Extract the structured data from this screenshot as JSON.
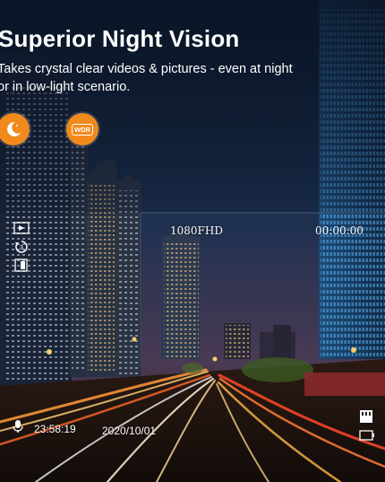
{
  "headline": "Superior Night Vision",
  "subtext": "Takes crystal clear videos & pictures - even at night\nor in low-light scenario.",
  "badges": [
    {
      "icon": "moon-icon",
      "color": "#f08a1c"
    },
    {
      "icon": "wdr-icon",
      "label": "WDR",
      "color": "#f08a1c"
    }
  ],
  "hud": {
    "resolution": "1080FHD",
    "timer": "00:00:00",
    "clock": "23:58:19",
    "date": "2020/10/01",
    "left_icons": [
      "video-mode-icon",
      "loop-record-icon",
      "sd-card-icon"
    ],
    "bottom_left_icon": "microphone-icon",
    "bottom_right_icons": [
      "memory-card-icon",
      "battery-icon"
    ]
  }
}
